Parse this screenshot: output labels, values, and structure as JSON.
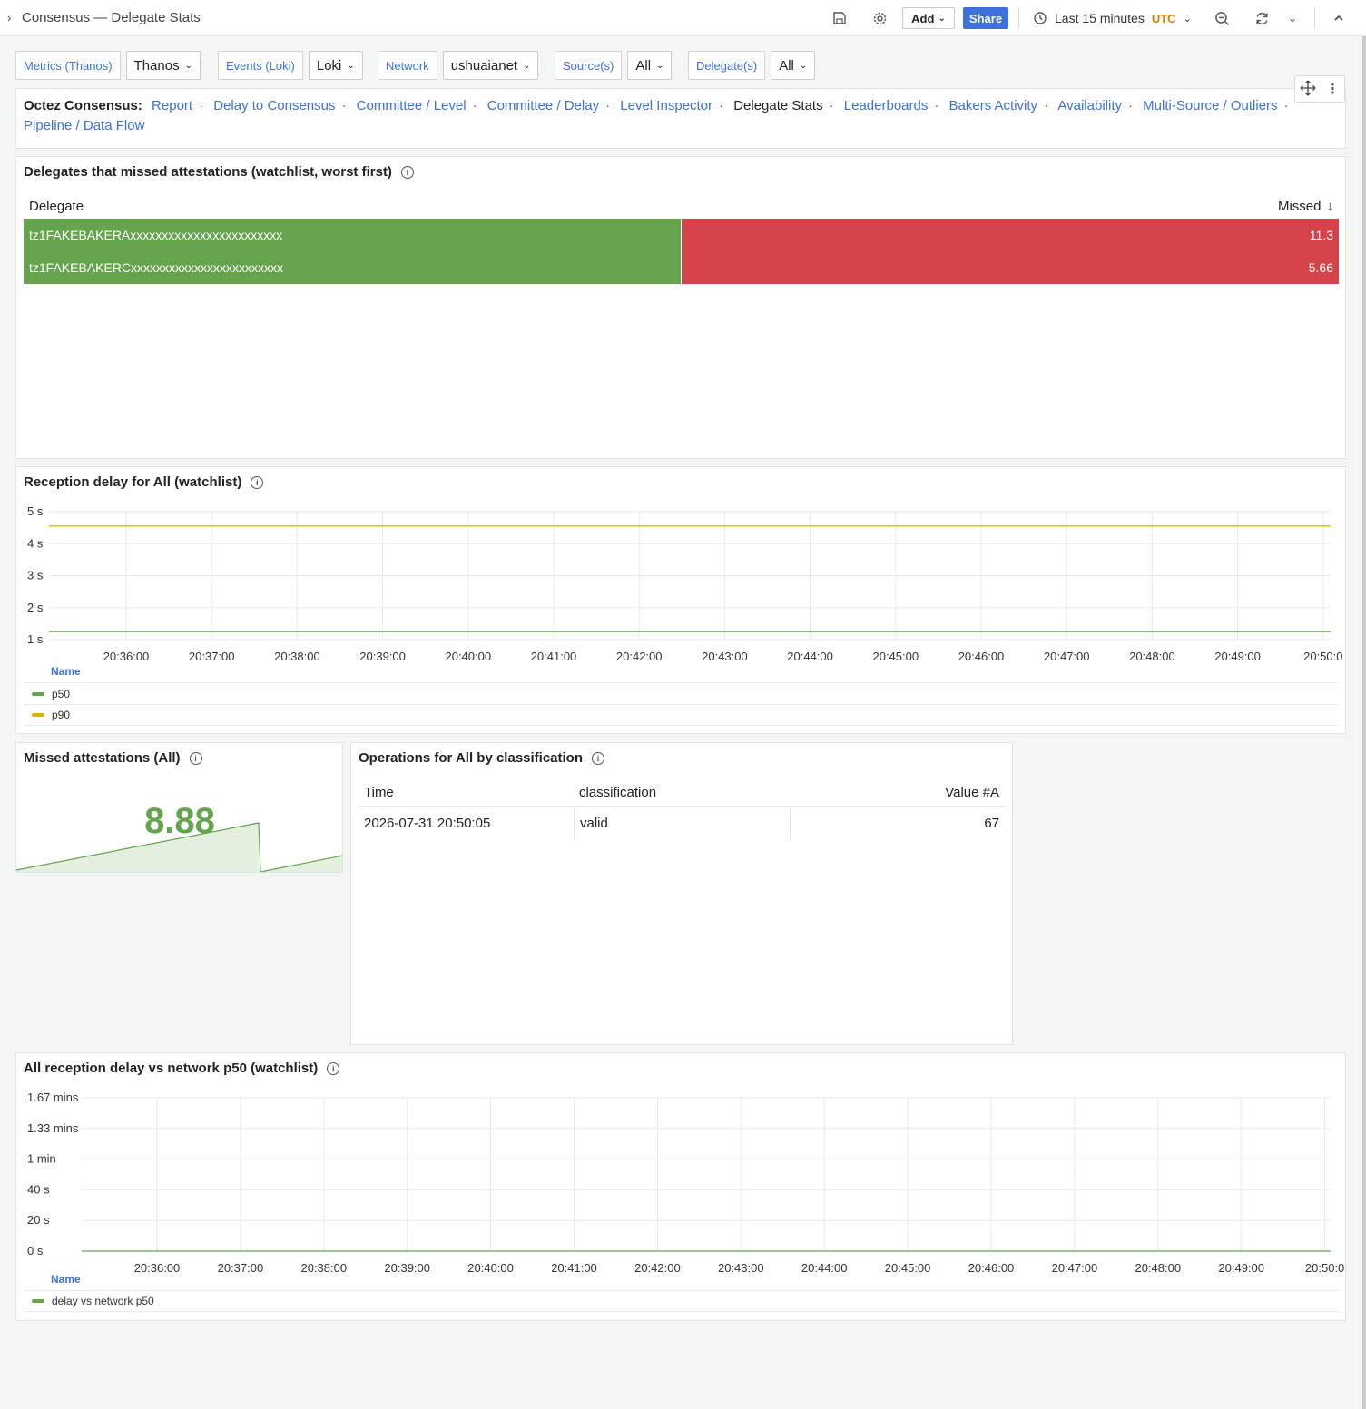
{
  "header": {
    "title": "Consensus — Delegate Stats",
    "add_label": "Add",
    "share_label": "Share",
    "time_range": "Last 15 minutes",
    "timezone": "UTC"
  },
  "variables": [
    {
      "label": "Metrics (Thanos)",
      "value": "Thanos"
    },
    {
      "label": "Events (Loki)",
      "value": "Loki"
    },
    {
      "label": "Network",
      "value": "ushuaianet"
    },
    {
      "label": "Source(s)",
      "value": "All"
    },
    {
      "label": "Delegate(s)",
      "value": "All"
    }
  ],
  "nav": {
    "lead": "Octez Consensus:",
    "links": [
      "Report",
      "Delay to Consensus",
      "Committee / Level",
      "Committee / Delay",
      "Level Inspector",
      "Delegate Stats",
      "Leaderboards",
      "Bakers Activity",
      "Availability",
      "Multi-Source / Outliers",
      "Pipeline / Data Flow"
    ],
    "current": "Delegate Stats"
  },
  "missed_panel": {
    "title": "Delegates that missed attestations (watchlist, worst first)",
    "col_delegate": "Delegate",
    "col_missed": "Missed",
    "rows": [
      {
        "delegate": "tz1FAKEBAKERAxxxxxxxxxxxxxxxxxxxxxxxx",
        "missed": "11.3"
      },
      {
        "delegate": "tz1FAKEBAKERCxxxxxxxxxxxxxxxxxxxxxxxx",
        "missed": "5.66"
      }
    ]
  },
  "reception_panel": {
    "title": "Reception delay for All (watchlist)",
    "legend_header": "Name",
    "colors": {
      "p50": "#65a44c",
      "p90": "#d4b400"
    },
    "chart_data": {
      "type": "line",
      "x": [
        "20:36:00",
        "20:37:00",
        "20:38:00",
        "20:39:00",
        "20:40:00",
        "20:41:00",
        "20:42:00",
        "20:43:00",
        "20:44:00",
        "20:45:00",
        "20:46:00",
        "20:47:00",
        "20:48:00",
        "20:49:00",
        "20:50:0"
      ],
      "y_ticks": [
        "5 s",
        "4 s",
        "3 s",
        "2 s",
        "1 s"
      ],
      "ylim": [
        1,
        5
      ],
      "series": [
        {
          "name": "p50",
          "values": [
            1.25,
            1.25,
            1.25,
            1.25,
            1.25,
            1.25,
            1.25,
            1.25,
            1.25,
            1.25,
            1.25,
            1.25,
            1.25,
            1.25,
            1.25
          ]
        },
        {
          "name": "p90",
          "values": [
            4.55,
            4.55,
            4.55,
            4.55,
            4.55,
            4.55,
            4.55,
            4.55,
            4.55,
            4.55,
            4.55,
            4.55,
            4.55,
            4.55,
            4.55
          ]
        }
      ]
    }
  },
  "stat_panel": {
    "title": "Missed attestations (All)",
    "value": "8.88"
  },
  "ops_panel": {
    "title": "Operations for All by classification",
    "columns": [
      "Time",
      "classification",
      "Value #A"
    ],
    "rows": [
      {
        "time": "2026-07-31 20:50:05",
        "classification": "valid",
        "value": "67"
      }
    ]
  },
  "network_panel": {
    "title": "All reception delay vs network p50 (watchlist)",
    "legend_header": "Name",
    "colors": {
      "series": "#65a44c"
    },
    "chart_data": {
      "type": "line",
      "x": [
        "20:36:00",
        "20:37:00",
        "20:38:00",
        "20:39:00",
        "20:40:00",
        "20:41:00",
        "20:42:00",
        "20:43:00",
        "20:44:00",
        "20:45:00",
        "20:46:00",
        "20:47:00",
        "20:48:00",
        "20:49:00",
        "20:50:0"
      ],
      "y_ticks": [
        "1.67 mins",
        "1.33 mins",
        "1 min",
        "40 s",
        "20 s",
        "0 s"
      ],
      "ylim": [
        0,
        100
      ],
      "series": [
        {
          "name": "delay vs network p50",
          "values": [
            0,
            0,
            0,
            0,
            0,
            0,
            0,
            0,
            0,
            0,
            0,
            0,
            0,
            0,
            0
          ]
        }
      ]
    }
  }
}
